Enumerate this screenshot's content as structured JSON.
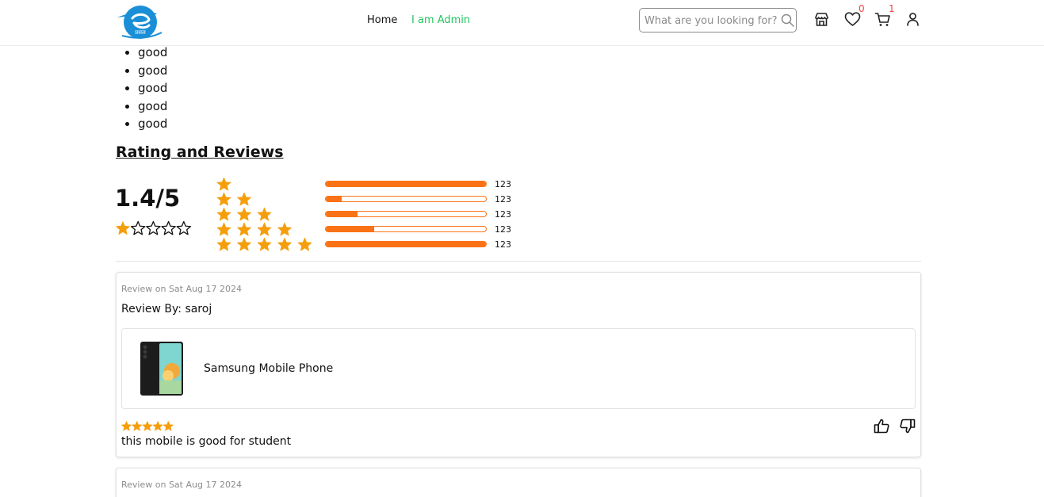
{
  "header": {
    "nav": {
      "home": "Home",
      "admin": "I am Admin"
    },
    "search": {
      "placeholder": "What are you looking for?"
    },
    "wishlist_count": "0",
    "cart_count": "1",
    "logo_text": "प्रसल"
  },
  "highlights": [
    "good",
    "good",
    "good",
    "good",
    "good"
  ],
  "ratings": {
    "heading": "Rating and Reviews",
    "average": "1.4/5",
    "average_value": 1.4,
    "max": 5,
    "breakdown": [
      {
        "stars": 1,
        "count": "123",
        "fill_fraction": 1.0
      },
      {
        "stars": 2,
        "count": "123",
        "fill_fraction": 0.1
      },
      {
        "stars": 3,
        "count": "123",
        "fill_fraction": 0.2
      },
      {
        "stars": 4,
        "count": "123",
        "fill_fraction": 0.3
      },
      {
        "stars": 5,
        "count": "123",
        "fill_fraction": 1.0
      }
    ]
  },
  "reviews": [
    {
      "date": "Review on Sat Aug 17 2024",
      "author": "Review By: saroj",
      "product_name": "Samsung Mobile Phone",
      "rating": 5,
      "text": "this mobile is good for student"
    },
    {
      "date": "Review on Sat Aug 17 2024"
    }
  ],
  "colors": {
    "accent_green": "#22c55e",
    "star": "#f59e0b",
    "bar": "#f97316",
    "badge": "#ef4444",
    "logo_blue": "#1a8fd8"
  }
}
